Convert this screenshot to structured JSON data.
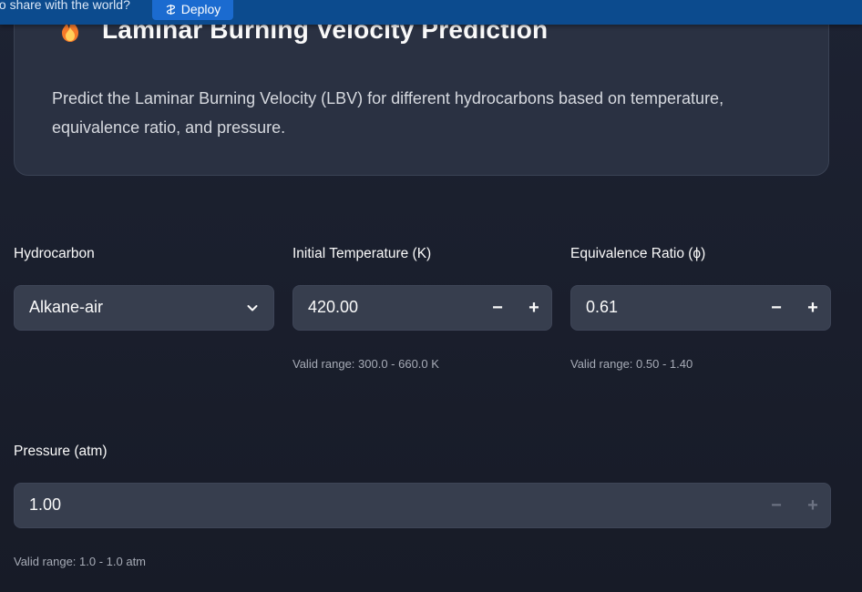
{
  "topbar": {
    "prompt_text": "to share with the world?",
    "deploy_label": "Deploy"
  },
  "hero": {
    "title": "Laminar Burning Velocity Prediction",
    "description": "Predict the Laminar Burning Velocity (LBV) for different hydrocarbons based on temperature, equivalence ratio, and pressure."
  },
  "inputs": {
    "hydrocarbon": {
      "label": "Hydrocarbon",
      "value": "Alkane-air"
    },
    "temperature": {
      "label": "Initial Temperature (K)",
      "value": "420.00",
      "hint": "Valid range: 300.0 - 660.0 K"
    },
    "equivalence": {
      "label": "Equivalence Ratio (ϕ)",
      "value": "0.61",
      "hint": "Valid range: 0.50 - 1.40"
    },
    "pressure": {
      "label": "Pressure (atm)",
      "value": "1.00",
      "hint": "Valid range: 1.0 - 1.0 atm"
    }
  },
  "stepper": {
    "minus": "−",
    "plus": "+"
  },
  "colors": {
    "background": "#191d2a",
    "card": "#2a3142",
    "input": "#373e4e",
    "banner": "#0c4b8e",
    "deploy": "#1b6bd0"
  }
}
